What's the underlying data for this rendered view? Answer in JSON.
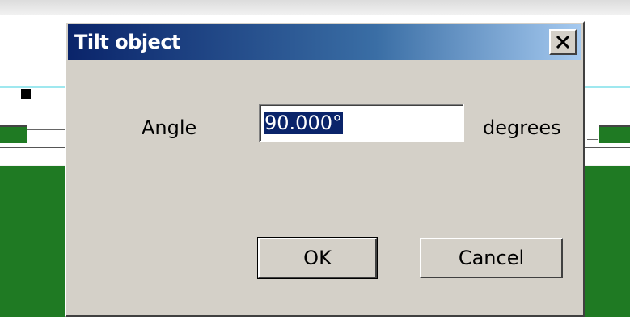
{
  "dialog": {
    "title": "Tilt object",
    "close_icon": "close-x-icon",
    "angle_label": "Angle",
    "angle_value": "90.000°",
    "degrees_label": "degrees",
    "ok_label": "OK",
    "cancel_label": "Cancel"
  },
  "colors": {
    "titlebar_start": "#0a246a",
    "titlebar_end": "#a6caf0",
    "dialog_face": "#d4d0c8",
    "canvas_green": "#1f7a23",
    "canvas_cyan": "#9fe8ef"
  }
}
